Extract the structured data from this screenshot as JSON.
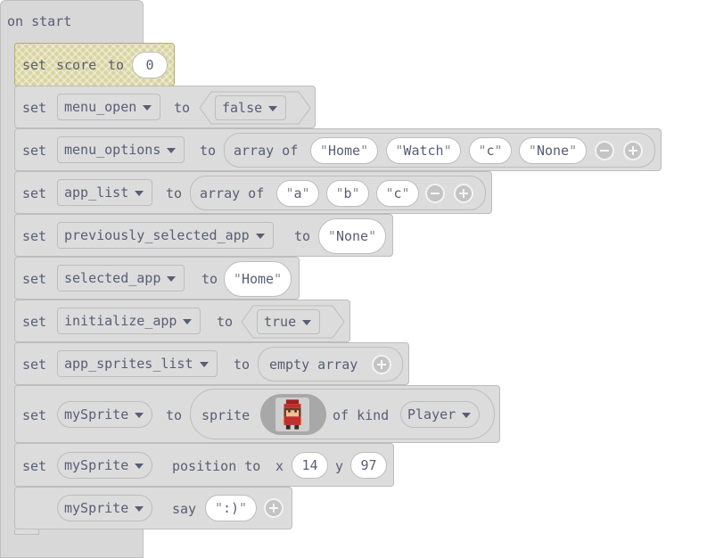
{
  "hat": {
    "label": "on start"
  },
  "blocks": {
    "score": {
      "set": "set",
      "name": "score",
      "to": "to",
      "value": "0"
    },
    "menu_open": {
      "set": "set",
      "var": "menu_open",
      "to": "to",
      "value": "false"
    },
    "menu_options": {
      "set": "set",
      "var": "menu_options",
      "to": "to",
      "array_of": "array of",
      "items": [
        "Home",
        "Watch",
        "c",
        "None"
      ]
    },
    "app_list": {
      "set": "set",
      "var": "app_list",
      "to": "to",
      "array_of": "array of",
      "items": [
        "a",
        "b",
        "c"
      ]
    },
    "previously_selected_app": {
      "set": "set",
      "var": "previously_selected_app",
      "to": "to",
      "value": "None"
    },
    "selected_app": {
      "set": "set",
      "var": "selected_app",
      "to": "to",
      "value": "Home"
    },
    "initialize_app": {
      "set": "set",
      "var": "initialize_app",
      "to": "to",
      "value": "true"
    },
    "app_sprites_list": {
      "set": "set",
      "var": "app_sprites_list",
      "to": "to",
      "value": "empty array"
    },
    "mySprite": {
      "set": "set",
      "var": "mySprite",
      "to": "to",
      "sprite": "sprite",
      "of_kind": "of kind",
      "kind": "Player"
    },
    "position": {
      "set": "set",
      "var": "mySprite",
      "position_to": "position to",
      "x_label": "x",
      "x": "14",
      "y_label": "y",
      "y": "97"
    },
    "say": {
      "var": "mySprite",
      "say": "say",
      "text": ":)"
    }
  },
  "colors": {
    "block": "#dcdcdc",
    "border": "#bdbdbd",
    "text": "#575e75",
    "score_block": "#d8d4a0"
  },
  "icons": {
    "minus": "minus-circle-icon",
    "plus": "plus-circle-icon",
    "dropdown": "chevron-down-icon"
  }
}
